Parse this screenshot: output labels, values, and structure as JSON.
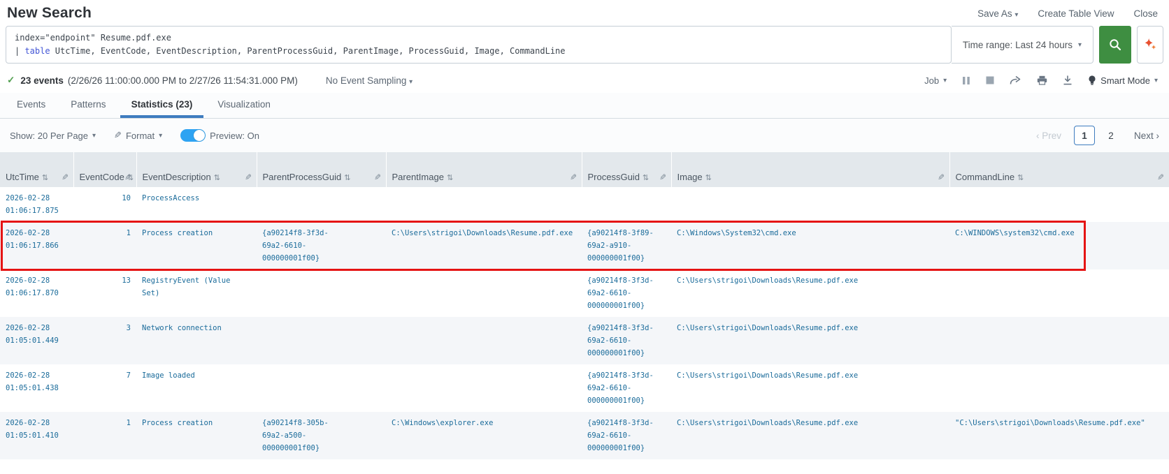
{
  "header": {
    "title": "New Search",
    "save_as": "Save As",
    "create_table_view": "Create Table View",
    "close": "Close"
  },
  "search": {
    "query_line1": "index=\"endpoint\" Resume.pdf.exe",
    "pipe": "| ",
    "command": "table",
    "query_rest": " UtcTime, EventCode, EventDescription, ParentProcessGuid, ParentImage, ProcessGuid, Image, CommandLine",
    "time_range": "Time range: Last 24 hours"
  },
  "results": {
    "count": "23 events",
    "range": "(2/26/26 11:00:00.000 PM to 2/27/26 11:54:31.000 PM)",
    "sampling": "No Event Sampling",
    "job": "Job",
    "mode": "Smart Mode"
  },
  "tabs": [
    {
      "label": "Events",
      "active": false
    },
    {
      "label": "Patterns",
      "active": false
    },
    {
      "label": "Statistics (23)",
      "active": true
    },
    {
      "label": "Visualization",
      "active": false
    }
  ],
  "controls": {
    "show": "Show: 20 Per Page",
    "format": "Format",
    "preview": "Preview: On",
    "prev": "‹ Prev",
    "next": "Next ›",
    "pages": [
      "1",
      "2"
    ],
    "current_page": "1"
  },
  "icons": {
    "caret": "▾",
    "sort": "⇅",
    "pencil": "✎",
    "check": "✓"
  },
  "colors": {
    "search_button_green": "#3e8e41",
    "highlight_red": "#e51414",
    "cell_link_blue": "#1a6b9a",
    "tab_active_blue": "#3e7cbf",
    "toggle_blue": "#2ea3f2",
    "spl_command_blue": "#4356d6",
    "check_green": "#53a051",
    "sparkle_orange": "#e8502f"
  },
  "table": {
    "columns": [
      "UtcTime",
      "EventCode",
      "EventDescription",
      "ParentProcessGuid",
      "ParentImage",
      "ProcessGuid",
      "Image",
      "CommandLine"
    ],
    "rows": [
      {
        "highlighted": false,
        "cells": [
          "2026-02-28 01:06:17.875",
          "10",
          "ProcessAccess",
          "",
          "",
          "",
          "",
          ""
        ]
      },
      {
        "highlighted": true,
        "cells": [
          "2026-02-28 01:06:17.866",
          "1",
          "Process creation",
          "{a90214f8-3f3d-69a2-6610-000000001f00}",
          "C:\\Users\\strigoi\\Downloads\\Resume.pdf.exe",
          "{a90214f8-3f89-69a2-a910-000000001f00}",
          "C:\\Windows\\System32\\cmd.exe",
          "C:\\WINDOWS\\system32\\cmd.exe"
        ]
      },
      {
        "highlighted": false,
        "cells": [
          "2026-02-28 01:06:17.870",
          "13",
          "RegistryEvent (Value Set)",
          "",
          "",
          "{a90214f8-3f3d-69a2-6610-000000001f00}",
          "C:\\Users\\strigoi\\Downloads\\Resume.pdf.exe",
          ""
        ]
      },
      {
        "highlighted": false,
        "cells": [
          "2026-02-28 01:05:01.449",
          "3",
          "Network connection",
          "",
          "",
          "{a90214f8-3f3d-69a2-6610-000000001f00}",
          "C:\\Users\\strigoi\\Downloads\\Resume.pdf.exe",
          ""
        ]
      },
      {
        "highlighted": false,
        "cells": [
          "2026-02-28 01:05:01.438",
          "7",
          "Image loaded",
          "",
          "",
          "{a90214f8-3f3d-69a2-6610-000000001f00}",
          "C:\\Users\\strigoi\\Downloads\\Resume.pdf.exe",
          ""
        ]
      },
      {
        "highlighted": false,
        "cells": [
          "2026-02-28 01:05:01.410",
          "1",
          "Process creation",
          "{a90214f8-305b-69a2-a500-000000001f00}",
          "C:\\Windows\\explorer.exe",
          "{a90214f8-3f3d-69a2-6610-000000001f00}",
          "C:\\Users\\strigoi\\Downloads\\Resume.pdf.exe",
          "\"C:\\Users\\strigoi\\Downloads\\Resume.pdf.exe\""
        ]
      }
    ]
  }
}
